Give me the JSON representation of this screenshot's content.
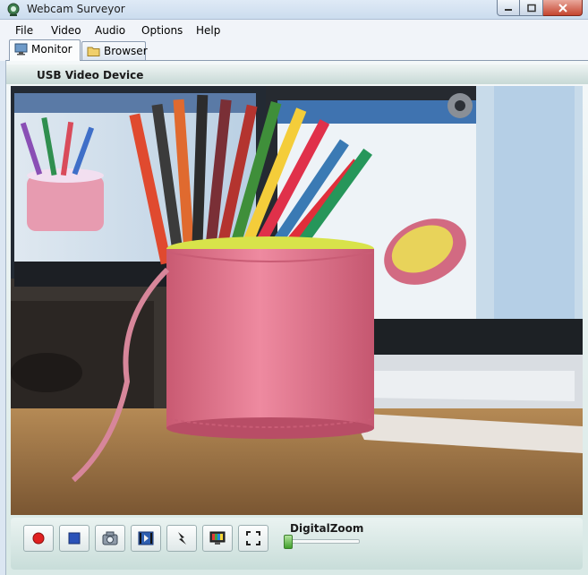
{
  "window": {
    "title": "Webcam Surveyor",
    "app_icon": "webcam-icon"
  },
  "menu": [
    "File",
    "Video",
    "Audio",
    "Options",
    "Help"
  ],
  "tabs": [
    {
      "label": "Monitor",
      "icon": "monitor-icon",
      "active": true
    },
    {
      "label": "Browser",
      "icon": "folder-icon",
      "active": false
    }
  ],
  "device": {
    "name": "USB Video Device"
  },
  "toolbar": {
    "buttons": [
      {
        "name": "record",
        "icon": "record-icon",
        "color": "#e02020"
      },
      {
        "name": "stop",
        "icon": "stop-icon",
        "color": "#2a52b8"
      },
      {
        "name": "snapshot",
        "icon": "camera-icon"
      },
      {
        "name": "video-capture",
        "icon": "film-icon"
      },
      {
        "name": "motion-detection",
        "icon": "lightning-icon"
      },
      {
        "name": "video-settings",
        "icon": "tv-icon"
      },
      {
        "name": "fullscreen",
        "icon": "fullscreen-icon"
      }
    ],
    "zoom_label": "DigitalZoom",
    "zoom_level": 0
  }
}
